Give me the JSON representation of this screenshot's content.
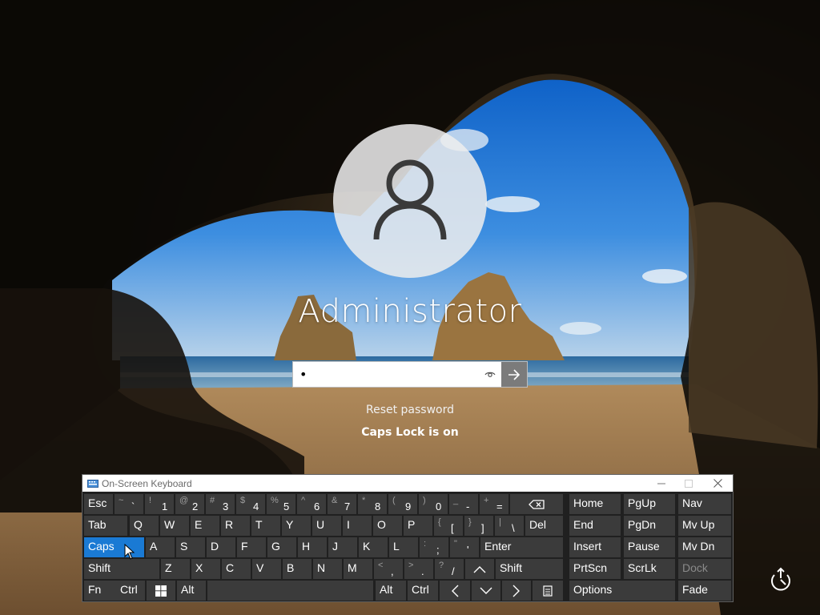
{
  "login": {
    "username": "Administrator",
    "password_value": "•",
    "reset_link": "Reset password",
    "caps_message": "Caps Lock is on"
  },
  "keyboard": {
    "title": "On-Screen Keyboard",
    "keys": [
      {
        "id": "esc",
        "label": "Esc"
      },
      {
        "id": "backquote",
        "shift": "~",
        "main": "`"
      },
      {
        "id": "1",
        "shift": "!",
        "main": "1"
      },
      {
        "id": "2",
        "shift": "@",
        "main": "2"
      },
      {
        "id": "3",
        "shift": "#",
        "main": "3"
      },
      {
        "id": "4",
        "shift": "$",
        "main": "4"
      },
      {
        "id": "5",
        "shift": "%",
        "main": "5"
      },
      {
        "id": "6",
        "shift": "^",
        "main": "6"
      },
      {
        "id": "7",
        "shift": "&",
        "main": "7"
      },
      {
        "id": "8",
        "shift": "*",
        "main": "8"
      },
      {
        "id": "9",
        "shift": "(",
        "main": "9"
      },
      {
        "id": "0",
        "shift": ")",
        "main": "0"
      },
      {
        "id": "minus",
        "shift": "_",
        "main": "-"
      },
      {
        "id": "equals",
        "shift": "+",
        "main": "="
      },
      {
        "id": "backspace",
        "icon": "backspace-icon"
      },
      {
        "id": "home",
        "label": "Home"
      },
      {
        "id": "pgup",
        "label": "PgUp"
      },
      {
        "id": "nav",
        "label": "Nav"
      },
      {
        "id": "tab",
        "label": "Tab"
      },
      {
        "id": "q",
        "label": "Q"
      },
      {
        "id": "w",
        "label": "W"
      },
      {
        "id": "e",
        "label": "E"
      },
      {
        "id": "r",
        "label": "R"
      },
      {
        "id": "t",
        "label": "T"
      },
      {
        "id": "y",
        "label": "Y"
      },
      {
        "id": "u",
        "label": "U"
      },
      {
        "id": "i",
        "label": "I"
      },
      {
        "id": "o",
        "label": "O"
      },
      {
        "id": "p",
        "label": "P"
      },
      {
        "id": "lbracket",
        "shift": "{",
        "main": "["
      },
      {
        "id": "rbracket",
        "shift": "}",
        "main": "]"
      },
      {
        "id": "backslash",
        "shift": "|",
        "main": "\\"
      },
      {
        "id": "del",
        "label": "Del"
      },
      {
        "id": "end",
        "label": "End"
      },
      {
        "id": "pgdn",
        "label": "PgDn"
      },
      {
        "id": "mvup",
        "label": "Mv Up"
      },
      {
        "id": "caps",
        "label": "Caps",
        "active": true
      },
      {
        "id": "a",
        "label": "A"
      },
      {
        "id": "s",
        "label": "S"
      },
      {
        "id": "d",
        "label": "D"
      },
      {
        "id": "f",
        "label": "F"
      },
      {
        "id": "g",
        "label": "G"
      },
      {
        "id": "h",
        "label": "H"
      },
      {
        "id": "j",
        "label": "J"
      },
      {
        "id": "k",
        "label": "K"
      },
      {
        "id": "l",
        "label": "L"
      },
      {
        "id": "semicolon",
        "shift": ":",
        "main": ";"
      },
      {
        "id": "quote",
        "shift": "\"",
        "main": "'"
      },
      {
        "id": "enter",
        "label": "Enter"
      },
      {
        "id": "insert",
        "label": "Insert"
      },
      {
        "id": "pause",
        "label": "Pause"
      },
      {
        "id": "mvdn",
        "label": "Mv Dn"
      },
      {
        "id": "lshift",
        "label": "Shift"
      },
      {
        "id": "z",
        "label": "Z"
      },
      {
        "id": "x",
        "label": "X"
      },
      {
        "id": "c",
        "label": "C"
      },
      {
        "id": "v",
        "label": "V"
      },
      {
        "id": "b",
        "label": "B"
      },
      {
        "id": "n",
        "label": "N"
      },
      {
        "id": "m",
        "label": "M"
      },
      {
        "id": "comma",
        "shift": "<",
        "main": ","
      },
      {
        "id": "period",
        "shift": ">",
        "main": "."
      },
      {
        "id": "slash",
        "shift": "?",
        "main": "/"
      },
      {
        "id": "up",
        "icon": "arrow-up-icon"
      },
      {
        "id": "rshift",
        "label": "Shift"
      },
      {
        "id": "prtscn",
        "label": "PrtScn"
      },
      {
        "id": "scrlk",
        "label": "ScrLk"
      },
      {
        "id": "dock",
        "label": "Dock",
        "disabled": true
      },
      {
        "id": "fn",
        "label": "Fn"
      },
      {
        "id": "lctrl",
        "label": "Ctrl"
      },
      {
        "id": "win",
        "icon": "windows-icon"
      },
      {
        "id": "lalt",
        "label": "Alt"
      },
      {
        "id": "space",
        "label": ""
      },
      {
        "id": "ralt",
        "label": "Alt"
      },
      {
        "id": "rctrl",
        "label": "Ctrl"
      },
      {
        "id": "left",
        "icon": "arrow-left-icon"
      },
      {
        "id": "down",
        "icon": "arrow-down-icon"
      },
      {
        "id": "right",
        "icon": "arrow-right-icon"
      },
      {
        "id": "menu",
        "icon": "context-menu-icon"
      },
      {
        "id": "options",
        "label": "Options"
      },
      {
        "id": "fade",
        "label": "Fade"
      }
    ]
  },
  "icons": {
    "avatar": "user-silhouette-icon",
    "reveal": "eye-icon",
    "submit": "arrow-right-icon",
    "ease": "ease-of-access-icon"
  },
  "colors": {
    "caps_active": "#1a7ad4",
    "key_bg": "#3b3b3b",
    "osk_bg": "#202020"
  }
}
